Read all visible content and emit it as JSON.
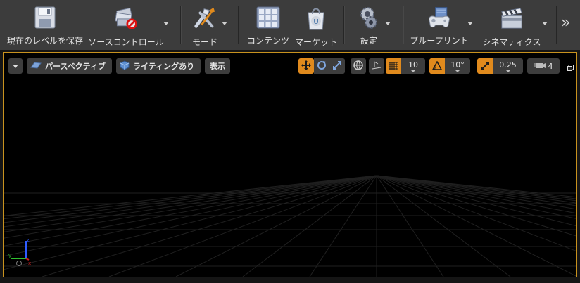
{
  "toolbar": {
    "items": [
      {
        "label": "現在のレベルを保存",
        "icon": "save-icon"
      },
      {
        "label": "ソースコントロール",
        "icon": "source-control-icon"
      },
      {
        "label": "モード",
        "icon": "modes-icon"
      },
      {
        "label": "コンテンツ",
        "icon": "content-icon"
      },
      {
        "label": "マーケット",
        "icon": "marketplace-icon"
      },
      {
        "label": "設定",
        "icon": "settings-icon"
      },
      {
        "label": "ブループリント",
        "icon": "blueprint-icon"
      },
      {
        "label": "シネマティクス",
        "icon": "cinematics-icon"
      }
    ],
    "more": "»"
  },
  "viewport": {
    "perspective_label": "パースペクティブ",
    "lighting_label": "ライティングあり",
    "show_label": "表示",
    "grid_snap": "10",
    "rotation_snap": "10°",
    "scale_snap": "0.25",
    "camera_speed": "4",
    "axis": {
      "x": "x",
      "y": "y",
      "z": "z"
    }
  },
  "colors": {
    "accent": "#e08a1d",
    "viewport_border": "#c8921e",
    "toolbar_bg": "#3c3c3c"
  }
}
